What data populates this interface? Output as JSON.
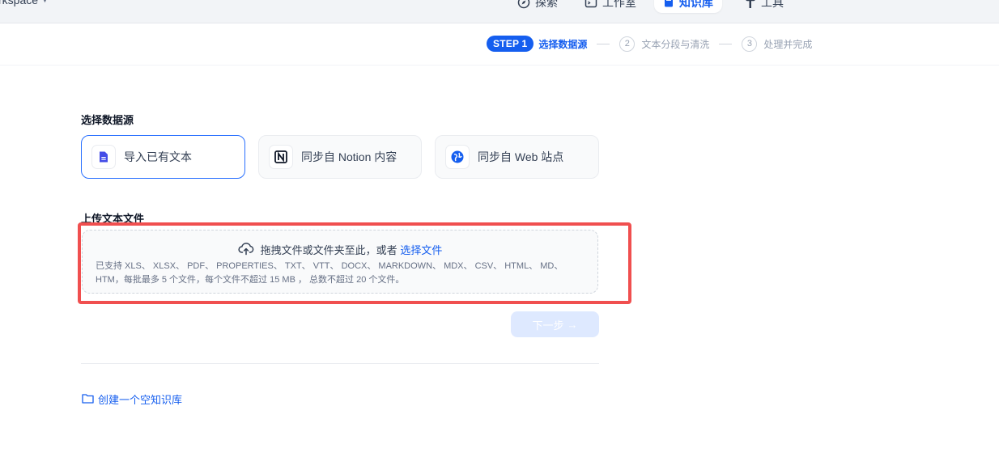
{
  "topbar": {
    "workspace_label": "rkspace",
    "nav": [
      {
        "label": "探索",
        "icon": "compass-icon"
      },
      {
        "label": "工作室",
        "icon": "terminal-window-icon"
      },
      {
        "label": "知识库",
        "icon": "book-icon",
        "active": true
      },
      {
        "label": "工具",
        "icon": "hammer-icon"
      }
    ]
  },
  "steps": {
    "current_badge": "STEP 1",
    "current_label": "选择数据源",
    "next": [
      {
        "num": "2",
        "label": "文本分段与清洗"
      },
      {
        "num": "3",
        "label": "处理并完成"
      }
    ]
  },
  "source": {
    "title": "选择数据源",
    "options": [
      {
        "label": "导入已有文本",
        "icon": "file-text-icon",
        "selected": true
      },
      {
        "label": "同步自 Notion 内容",
        "icon": "notion-icon",
        "selected": false
      },
      {
        "label": "同步自 Web 站点",
        "icon": "globe-icon",
        "selected": false
      }
    ]
  },
  "upload": {
    "title": "上传文本文件",
    "drop_text": "拖拽文件或文件夹至此，或者",
    "choose_link": "选择文件",
    "hint": "已支持 XLS、 XLSX、 PDF、 PROPERTIES、 TXT、 VTT、 DOCX、 MARKDOWN、 MDX、 CSV、 HTML、 MD、 HTM，每批最多 5 个文件，每个文件不超过 15 MB ， 总数不超过 20 个文件。"
  },
  "next_button": {
    "label": "下一步",
    "enabled": false
  },
  "create_empty": {
    "label": "创建一个空知识库"
  },
  "colors": {
    "accent": "#155eef",
    "highlight": "#f04f4f",
    "disabled_button": "#d1e0ff"
  }
}
